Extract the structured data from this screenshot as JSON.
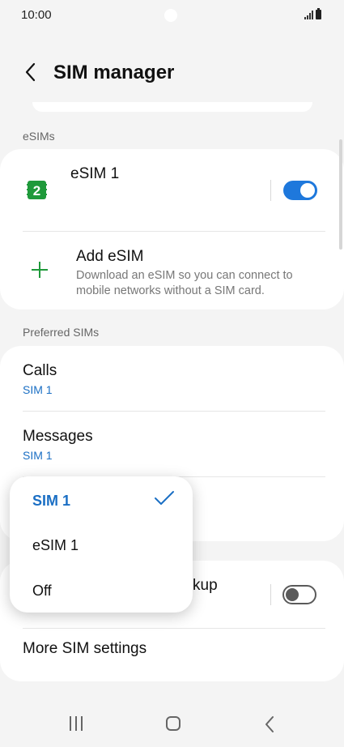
{
  "status": {
    "time": "10:00"
  },
  "header": {
    "title": "SIM manager"
  },
  "esims": {
    "section_label": "eSIMs",
    "esim1": {
      "label": "eSIM 1",
      "badge": "2",
      "toggle_on": true
    },
    "add": {
      "title": "Add eSIM",
      "description": "Download an eSIM so you can connect to mobile networks without a SIM card."
    }
  },
  "preferred": {
    "section_label": "Preferred SIMs",
    "calls": {
      "title": "Calls",
      "value": "SIM 1"
    },
    "messages": {
      "title": "Messages",
      "value": "SIM 1"
    }
  },
  "more": {
    "backup_partial": "kup",
    "backup_toggle_on": false,
    "more_settings": "More SIM settings"
  },
  "popup": {
    "options": [
      "SIM 1",
      "eSIM 1",
      "Off"
    ],
    "selected": "SIM 1"
  },
  "colors": {
    "accent": "#1e78dc",
    "link": "#1b6fc4",
    "esim_green": "#1f9a3b"
  },
  "icons": {
    "back": "chevron-left-icon",
    "check": "check-icon",
    "add": "plus-icon",
    "sim": "sim-card-icon"
  }
}
